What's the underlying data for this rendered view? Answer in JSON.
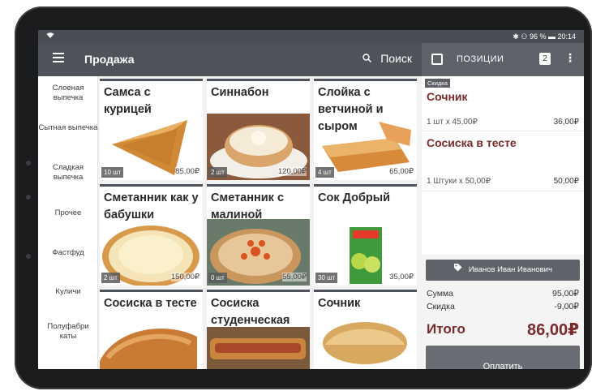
{
  "status": {
    "right": "✱ ⚇ 96 % ▬ 20:14"
  },
  "appbar": {
    "title": "Продажа",
    "search": "Поиск"
  },
  "cartbar": {
    "label": "ПОЗИЦИИ",
    "count": "2"
  },
  "sidebar": {
    "items": [
      {
        "label": "Слоеная выпечка"
      },
      {
        "label": "Сытная выпечка"
      },
      {
        "label": "Сладкая выпечка"
      },
      {
        "label": "Прочее"
      },
      {
        "label": "Фастфуд"
      },
      {
        "label": "Куличи"
      },
      {
        "label": "Полуфабри каты"
      }
    ]
  },
  "products": [
    {
      "name": "Самса с курицей",
      "qty": "10 шт",
      "price": "85,00₽"
    },
    {
      "name": "Синнабон",
      "qty": "2 шт",
      "price": "120,00₽"
    },
    {
      "name": "Слойка с ветчиной и сыром",
      "qty": "4 шт",
      "price": "65,00₽"
    },
    {
      "name": "Сметанник как у бабушки",
      "qty": "2 шт",
      "price": "150,00₽"
    },
    {
      "name": "Сметанник с малиной",
      "qty": "0 шт",
      "price": "55,00₽"
    },
    {
      "name": "Сок Добрый",
      "qty": "30 шт",
      "price": "35,00₽"
    },
    {
      "name": "Сосиска в тесте",
      "qty": "",
      "price": ""
    },
    {
      "name": "Сосиска студенческая",
      "qty": "",
      "price": ""
    },
    {
      "name": "Сочник",
      "qty": "",
      "price": ""
    }
  ],
  "cart": {
    "badge": "Скидка",
    "items": [
      {
        "name": "Сочник",
        "line": "1 шт x 45,00₽",
        "sum": "36,00₽"
      },
      {
        "name": "Сосиска в тесте",
        "line": "1 Штуки x 50,00₽",
        "sum": "50,00₽"
      }
    ],
    "client": "Иванов Иван Иванович",
    "sum_label": "Сумма",
    "sum_value": "95,00₽",
    "discount_label": "Скидка",
    "discount_value": "-9,00₽",
    "total_label": "Итого",
    "total_value": "86,00₽",
    "pay_label": "Оплатить"
  },
  "colors": {
    "header": "#4e5259",
    "accent": "#7a2a2a",
    "tile_border": "#4e5259"
  },
  "icons": [
    "wifi-icon",
    "menu-icon",
    "search-icon",
    "checkbox-icon",
    "more-vert-icon",
    "tag-icon"
  ]
}
